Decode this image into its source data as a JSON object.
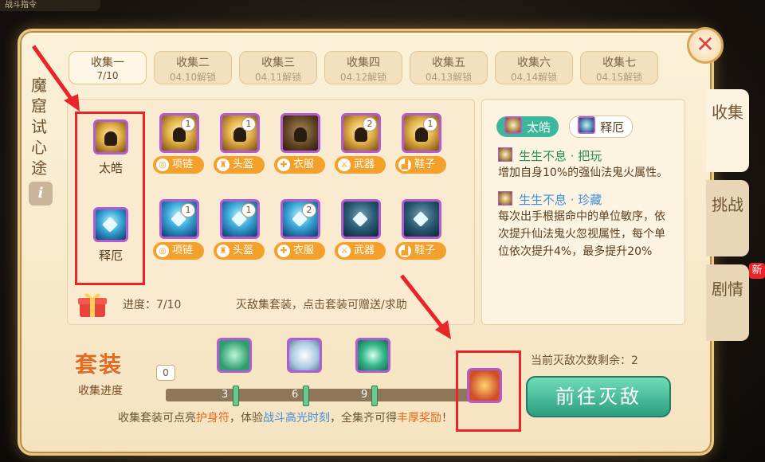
{
  "topbar": {
    "text": "战斗指令"
  },
  "side_title": [
    "魔",
    "窟",
    "试",
    "心",
    "途"
  ],
  "info_icon": "i",
  "tabs": [
    {
      "name": "收集一",
      "sub": "7/10",
      "active": true
    },
    {
      "name": "收集二",
      "sub": "04.10解锁",
      "active": false
    },
    {
      "name": "收集三",
      "sub": "04.11解锁",
      "active": false
    },
    {
      "name": "收集四",
      "sub": "04.12解锁",
      "active": false
    },
    {
      "name": "收集五",
      "sub": "04.13解锁",
      "active": false
    },
    {
      "name": "收集六",
      "sub": "04.14解锁",
      "active": false
    },
    {
      "name": "收集七",
      "sub": "04.15解锁",
      "active": false
    }
  ],
  "sets": [
    {
      "name": "太皓",
      "style": "gold",
      "pieces": [
        {
          "label": "项链",
          "count": "1",
          "owned": true
        },
        {
          "label": "头盔",
          "count": "1",
          "owned": true
        },
        {
          "label": "衣服",
          "count": "",
          "owned": false
        },
        {
          "label": "武器",
          "count": "2",
          "owned": true
        },
        {
          "label": "鞋子",
          "count": "1",
          "owned": true
        }
      ]
    },
    {
      "name": "释厄",
      "style": "blue",
      "pieces": [
        {
          "label": "项链",
          "count": "1",
          "owned": true
        },
        {
          "label": "头盔",
          "count": "1",
          "owned": true
        },
        {
          "label": "衣服",
          "count": "2",
          "owned": true
        },
        {
          "label": "武器",
          "count": "",
          "owned": false
        },
        {
          "label": "鞋子",
          "count": "",
          "owned": false
        }
      ]
    }
  ],
  "progress": {
    "label": "进度：7/10",
    "hint": "灭敌集套装，点击套装可赠送/求助"
  },
  "detail": {
    "tabs": [
      {
        "label": "太皓",
        "active": true
      },
      {
        "label": "释厄",
        "active": false
      }
    ],
    "skills": [
      {
        "title": "生生不息 · 把玩",
        "color": "green",
        "desc": "增加自身10%的强仙法鬼火属性。"
      },
      {
        "title": "生生不息 · 珍藏",
        "color": "blue",
        "desc": "每次出手根据命中的单位敏序，依次提升仙法鬼火忽视属性，每个单位依次提升4%，最多提升20%"
      }
    ]
  },
  "side_tabs": [
    {
      "label": "收集",
      "active": true
    },
    {
      "label": "挑战",
      "active": false
    },
    {
      "label": "剧情",
      "active": false,
      "badge": "新"
    }
  ],
  "suit": {
    "title": "套装",
    "sub": "收集进度",
    "count": "0"
  },
  "milestones": [
    {
      "value": "3",
      "icon": "jade-icon"
    },
    {
      "value": "6",
      "icon": "mirror-icon"
    },
    {
      "value": "9",
      "icon": "amulet-icon"
    }
  ],
  "footer": {
    "pre": "收集套装可点亮",
    "h1": "护身符",
    "mid": "，体验",
    "h2": "战斗高光时刻",
    "mid2": "，全集齐可得",
    "h3": "丰厚奖励",
    "end": "！"
  },
  "remain": "当前灭敌次数剩余：2",
  "go_button": "前往灭敌",
  "close_icon": "✕",
  "colors": {
    "accent_green": "#3bb89a",
    "annotation_red": "#e8262a",
    "highlight_orange": "#e36a1a"
  }
}
